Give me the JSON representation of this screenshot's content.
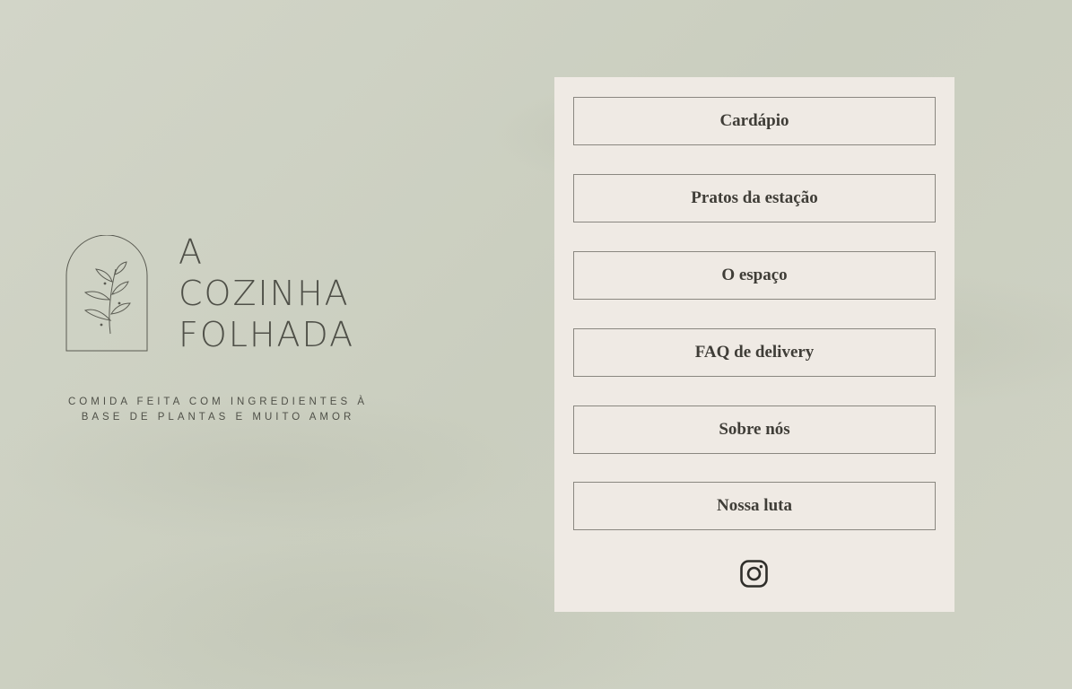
{
  "brand": {
    "logo_lines": [
      "A",
      "COZINHA",
      "FOLHADA"
    ],
    "tagline_lines": [
      "COMIDA FEITA COM INGREDIENTES À",
      "BASE DE PLANTAS E MUITO AMOR"
    ]
  },
  "menu": {
    "items": [
      {
        "label": "Cardápio"
      },
      {
        "label": "Pratos da estação"
      },
      {
        "label": "O espaço"
      },
      {
        "label": "FAQ de delivery"
      },
      {
        "label": "Sobre nós"
      },
      {
        "label": "Nossa luta"
      }
    ]
  },
  "social": {
    "icon": "instagram-icon"
  },
  "colors": {
    "background": "#cdd0c2",
    "panel": "#efeae4",
    "text": "#3f3d37"
  }
}
